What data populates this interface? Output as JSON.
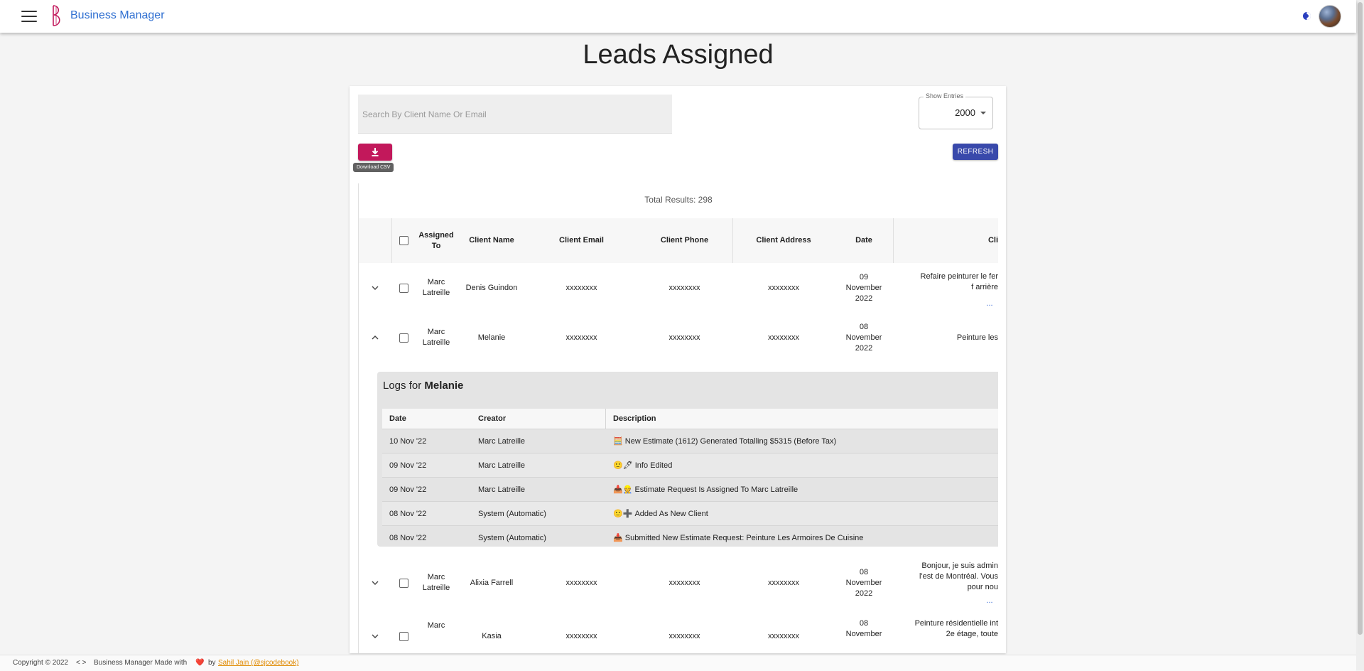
{
  "app": {
    "brand": "Business Manager"
  },
  "page": {
    "title": "Leads Assigned"
  },
  "toolbar": {
    "search_placeholder": "Search By Client Name Or Email",
    "entries_label": "Show Entries",
    "entries_value": "2000",
    "download_tooltip": "Download CSV",
    "refresh_label": "REFRESH"
  },
  "table": {
    "total": "Total Results: 298",
    "columns": [
      "Assigned To",
      "Client Name",
      "Client Email",
      "Client Phone",
      "Client Address",
      "Date",
      "Cli"
    ],
    "rows": [
      {
        "assigned": "Marc Latreille",
        "name": "Denis Guindon",
        "email": "xxxxxxxx",
        "phone": "xxxxxxxx",
        "address": "xxxxxxxx",
        "date": "09 November 2022",
        "desc": "Refaire peinturer le fer f arrière",
        "more": "..."
      },
      {
        "assigned": "Marc Latreille",
        "name": "Melanie",
        "email": "xxxxxxxx",
        "phone": "xxxxxxxx",
        "address": "xxxxxxxx",
        "date": "08 November 2022",
        "desc": "Peinture les",
        "more": ""
      },
      {
        "assigned": "Marc Latreille",
        "name": "Alixia Farrell",
        "email": "xxxxxxxx",
        "phone": "xxxxxxxx",
        "address": "xxxxxxxx",
        "date": "08 November 2022",
        "desc": "Bonjour, je suis admin l'est de Montréal. Vous pour nou",
        "more": "..."
      },
      {
        "assigned": "Marc",
        "name": "Kasia",
        "email": "xxxxxxxx",
        "phone": "xxxxxxxx",
        "address": "xxxxxxxx",
        "date": "08 November",
        "desc": "Peinture résidentielle int 2e étage, toute",
        "more": ""
      }
    ]
  },
  "logs": {
    "prefix": "Logs for ",
    "client": "Melanie",
    "columns": [
      "Date",
      "Creator",
      "Description"
    ],
    "rows": [
      {
        "date": "10 Nov '22",
        "creator": "Marc Latreille",
        "icon": "🧮",
        "desc": "New Estimate (1612) Generated Totalling $5315 (Before Tax)"
      },
      {
        "date": "09 Nov '22",
        "creator": "Marc Latreille",
        "icon": "🙂🖊",
        "desc": "Info Edited"
      },
      {
        "date": "09 Nov '22",
        "creator": "Marc Latreille",
        "icon": "📥👷",
        "desc": "Estimate Request Is Assigned To Marc Latreille"
      },
      {
        "date": "08 Nov '22",
        "creator": "System (Automatic)",
        "icon": "🙂➕",
        "desc": "Added As New Client"
      },
      {
        "date": "08 Nov '22",
        "creator": "System (Automatic)",
        "icon": "📥",
        "desc": "Submitted New Estimate Request: Peinture Les Armoires De Cuisine"
      }
    ]
  },
  "footer": {
    "copyright": "Copyright © 2022",
    "code": "< >",
    "made": "Business Manager Made with",
    "heart": "❤️",
    "by": "by",
    "author": "Sahil Jain (@sjcodebook)"
  },
  "colors": {
    "accent": "#2f6fd1",
    "csv_button": "#c2185b",
    "refresh_button": "#3949ab",
    "logo": "#c2185b"
  }
}
